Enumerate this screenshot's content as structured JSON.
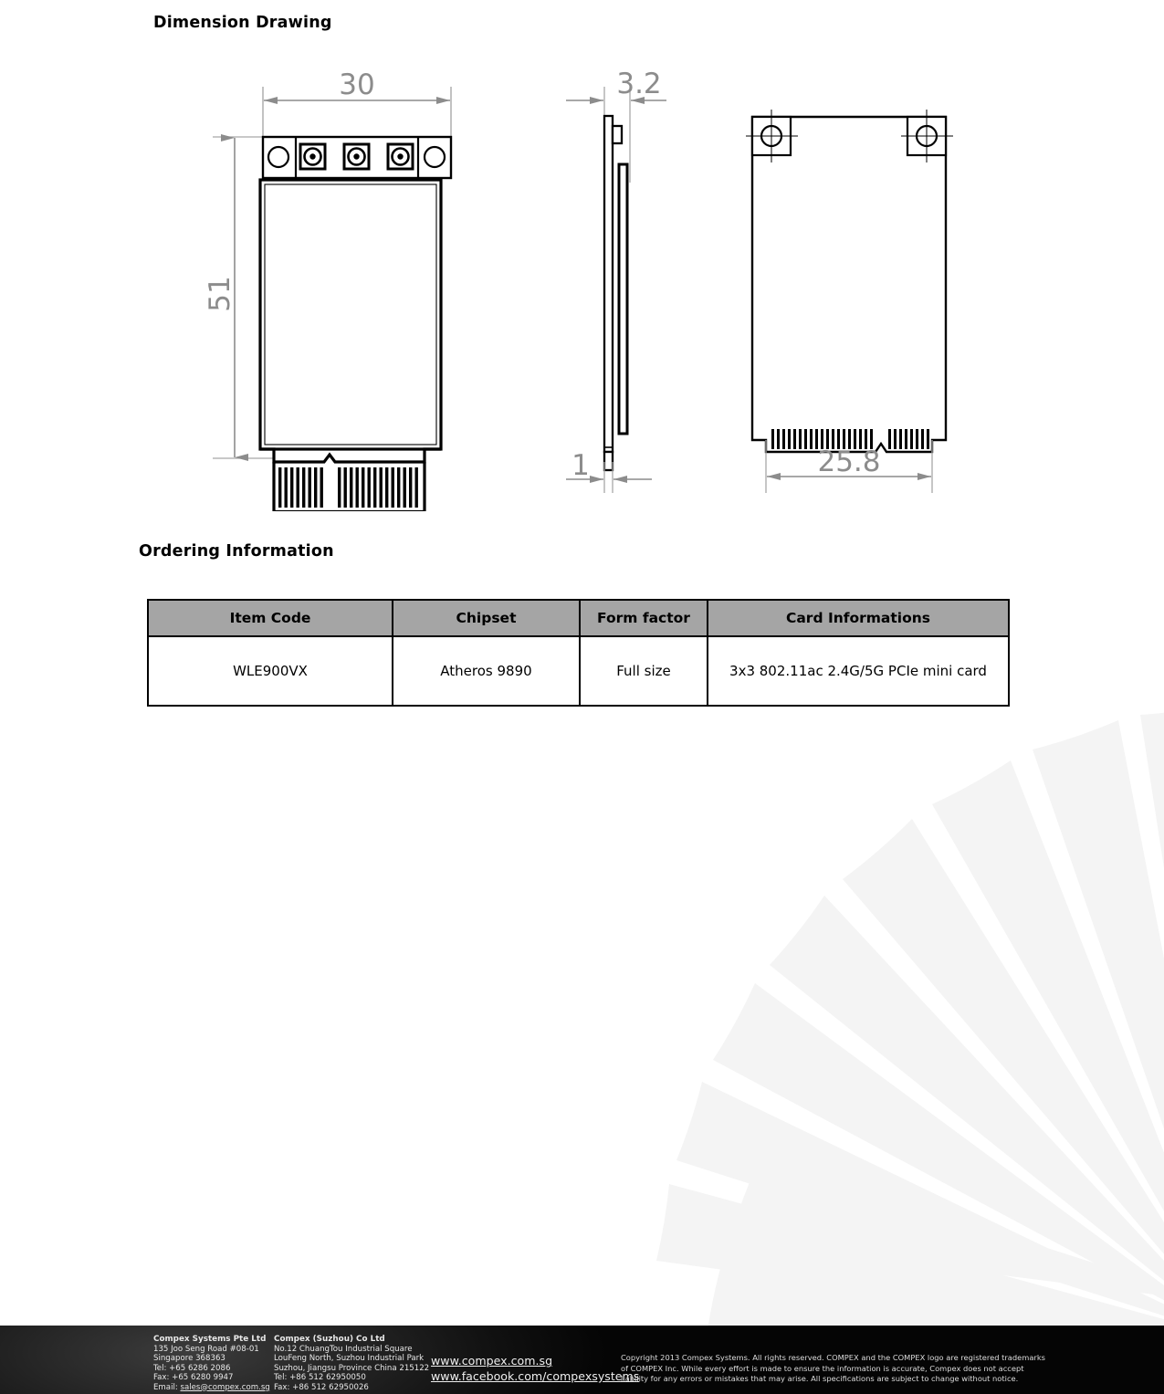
{
  "sections": {
    "dimension_title": "Dimension Drawing",
    "ordering_title": "Ordering Information"
  },
  "drawing": {
    "front_view": {
      "width_label": "30",
      "height_label": "51",
      "mounting_holes": 2,
      "ufl_connectors": 3
    },
    "side_view": {
      "thickness_label": "3.2",
      "pcb_label": "1"
    },
    "back_view": {
      "width_label": "25.8",
      "mounting_holes": 2
    }
  },
  "table": {
    "headers": [
      "Item Code",
      "Chipset",
      "Form factor",
      "Card Informations"
    ],
    "rows": [
      [
        "WLE900VX",
        "Atheros 9890",
        "Full size",
        "3x3 802.11ac 2.4G/5G PCIe mini card"
      ]
    ]
  },
  "footer": {
    "company_sg": {
      "name": "Compex Systems Pte Ltd",
      "lines": [
        "135 Joo Seng Road #08-01",
        "Singapore 368363",
        "Tel:  +65 6286 2086",
        "Fax: +65 6280 9947"
      ],
      "email_label": "Email: ",
      "email": "sales@compex.com.sg"
    },
    "company_cn": {
      "name": "Compex (Suzhou) Co Ltd",
      "lines": [
        "No.12 ChuangTou Industrial Square",
        "LouFeng North, Suzhou Industrial Park",
        "Suzhou, Jiangsu Province China 215122",
        "Tel: +86 512 62950050",
        "Fax: +86 512 62950026"
      ]
    },
    "links": [
      "www.compex.com.sg",
      "www.facebook.com/compexsystems"
    ],
    "copyright": [
      "Copyright 2013 Compex Systems. All rights reserved. COMPEX and the COMPEX logo are registered trademarks",
      "of COMPEX Inc. While every effort is made to ensure the information is accurate, Compex does not accept",
      "liability for any errors or mistakes that may arise. All specifications are subject to change without notice."
    ]
  },
  "colors": {
    "table_header_bg": "#a5a5a5",
    "dimension_text": "#8c8c8c",
    "drawing_line": "#000000",
    "watermark": "#f4f4f4",
    "footer_bg": "#111111"
  }
}
